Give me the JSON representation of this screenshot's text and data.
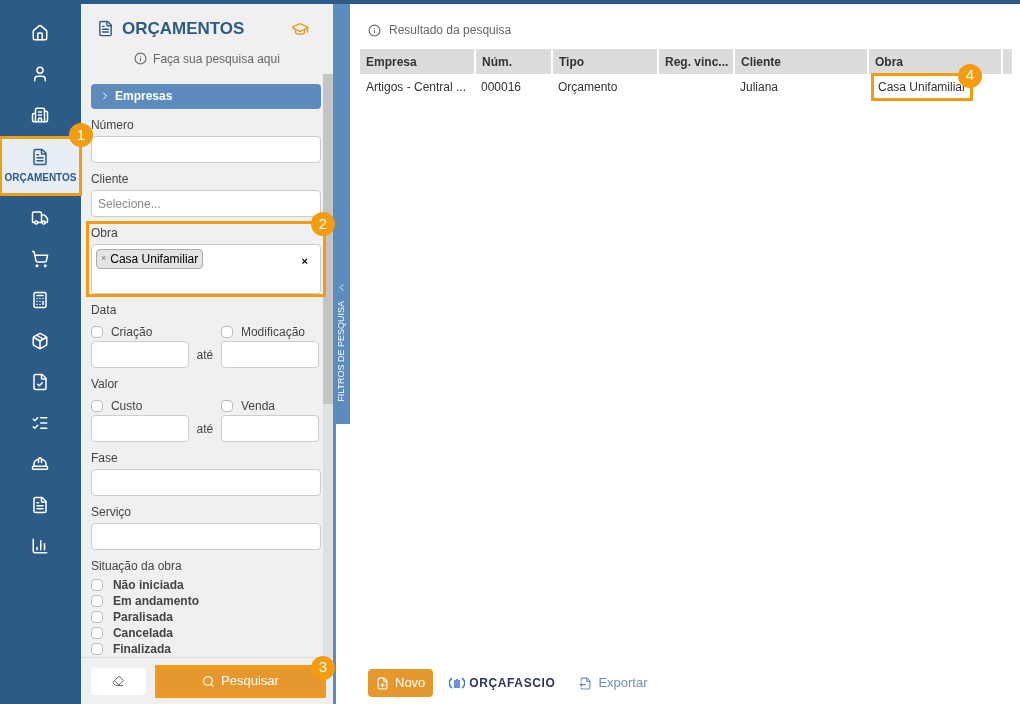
{
  "nav": {
    "items": [
      {
        "selected": false
      },
      {
        "selected": false
      },
      {
        "selected": false
      },
      {
        "label": "ORÇAMENTOS",
        "selected": true,
        "callout": "1"
      },
      {
        "selected": false
      },
      {
        "selected": false
      },
      {
        "selected": false
      },
      {
        "selected": false
      },
      {
        "selected": false
      },
      {
        "selected": false
      },
      {
        "selected": false
      },
      {
        "selected": false
      },
      {
        "selected": false
      }
    ]
  },
  "filters": {
    "title": "ORÇAMENTOS",
    "hint": "Faça sua pesquisa aqui",
    "section": {
      "label": "Empresas",
      "expanded": false
    },
    "fields": [
      {
        "kind": "text",
        "label": "Número"
      },
      {
        "kind": "select",
        "label": "Cliente",
        "placeholder": "Selecione..."
      },
      {
        "kind": "tags",
        "label": "Obra",
        "tags": [
          {
            "label": "Casa Unifamiliar",
            "remove": "×"
          }
        ],
        "clear": "×",
        "callout": "2"
      },
      {
        "kind": "range",
        "label": "Data",
        "from": {
          "label": "Criação",
          "checked": false
        },
        "to": {
          "label": "Modificação",
          "checked": false
        },
        "separator": "até"
      },
      {
        "kind": "range",
        "label": "Valor",
        "from": {
          "label": "Custo",
          "checked": false
        },
        "to": {
          "label": "Venda",
          "checked": false
        },
        "separator": "até"
      },
      {
        "kind": "text",
        "label": "Fase"
      },
      {
        "kind": "text",
        "label": "Serviço"
      },
      {
        "kind": "checks",
        "label": "Situação da obra",
        "options": [
          {
            "label": "Não iniciada",
            "checked": false
          },
          {
            "label": "Em andamento",
            "checked": false
          },
          {
            "label": "Paralisada",
            "checked": false
          },
          {
            "label": "Cancelada",
            "checked": false
          },
          {
            "label": "Finalizada",
            "checked": false
          }
        ]
      }
    ],
    "search_button": {
      "label": "Pesquisar",
      "callout": "3"
    },
    "collapse_tab": "FILTROS DE PESQUISA"
  },
  "results": {
    "title": "Resultado da pesquisa",
    "table": {
      "columns": [
        "Empresa",
        "Núm.",
        "Tipo",
        "Reg. vinc...",
        "Cliente",
        "Obra"
      ],
      "rows": [
        {
          "cells": [
            {
              "text": "Artigos - Central ..."
            },
            {
              "text": "000016"
            },
            {
              "text": "Orçamento"
            },
            {
              "text": ""
            },
            {
              "text": "Juliana"
            },
            {
              "text": "Casa Unifamiliar",
              "callout": "4"
            }
          ]
        }
      ]
    },
    "footer": {
      "new_button": "Novo",
      "logo": "ORÇAFASCIO",
      "export_link": "Exportar"
    }
  }
}
